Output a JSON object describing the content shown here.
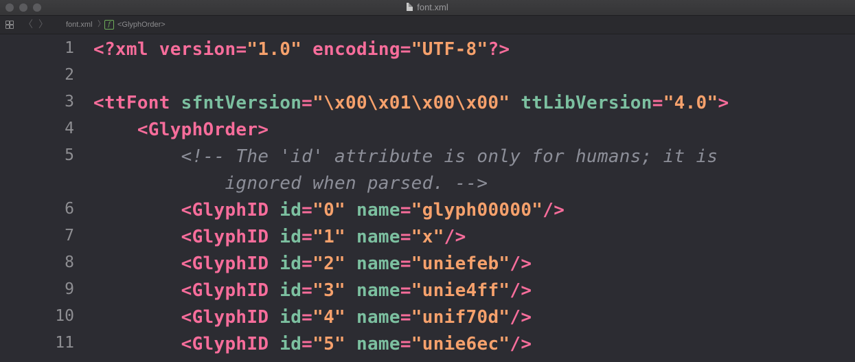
{
  "window": {
    "title": "font.xml"
  },
  "jumpbar": {
    "back_glyph": "〈",
    "forward_glyph": "〉",
    "crumb_file": "font.xml",
    "crumb_separator": "〉",
    "crumb_symbol": "f",
    "crumb_element": "<GlyphOrder>"
  },
  "editor": {
    "line_numbers": [
      "1",
      "2",
      "3",
      "4",
      "5",
      "6",
      "7",
      "8",
      "9",
      "10",
      "11"
    ],
    "line1": {
      "open": "<?xml",
      "attr1": "version",
      "eq1": "=",
      "val1": "\"1.0\"",
      "attr2": "encoding",
      "eq2": "=",
      "val2": "\"UTF-8\"",
      "close": "?>"
    },
    "line3": {
      "open": "<ttFont",
      "attr1": "sfntVersion",
      "eq1": "=",
      "val1": "\"\\x00\\x01\\x00\\x00\"",
      "attr2": "ttLibVersion",
      "eq2": "=",
      "val2": "\"4.0\"",
      "close": ">"
    },
    "line4": {
      "tag": "<GlyphOrder>"
    },
    "line5": {
      "comment_part1": "<!-- The 'id' attribute is only for humans; it is",
      "comment_part2": "ignored when parsed. -->"
    },
    "glyph_rows": [
      {
        "tag": "<GlyphID",
        "id_attr": "id",
        "id_val": "\"0\"",
        "name_attr": "name",
        "name_val": "\"glyph00000\"",
        "close": "/>"
      },
      {
        "tag": "<GlyphID",
        "id_attr": "id",
        "id_val": "\"1\"",
        "name_attr": "name",
        "name_val": "\"x\"",
        "close": "/>"
      },
      {
        "tag": "<GlyphID",
        "id_attr": "id",
        "id_val": "\"2\"",
        "name_attr": "name",
        "name_val": "\"uniefeb\"",
        "close": "/>"
      },
      {
        "tag": "<GlyphID",
        "id_attr": "id",
        "id_val": "\"3\"",
        "name_attr": "name",
        "name_val": "\"unie4ff\"",
        "close": "/>"
      },
      {
        "tag": "<GlyphID",
        "id_attr": "id",
        "id_val": "\"4\"",
        "name_attr": "name",
        "name_val": "\"unif70d\"",
        "close": "/>"
      },
      {
        "tag": "<GlyphID",
        "id_attr": "id",
        "id_val": "\"5\"",
        "name_attr": "name",
        "name_val": "\"unie6ec\"",
        "close": "/>"
      }
    ]
  },
  "colors": {
    "background": "#2c2c32",
    "tag": "#f76d9b",
    "attribute": "#7cc0a0",
    "string": "#f6a16c",
    "comment": "#8d8f99",
    "line_number": "#8e8e92"
  }
}
